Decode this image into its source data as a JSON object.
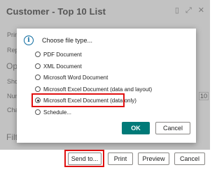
{
  "window": {
    "title": "Customer - Top 10 List"
  },
  "background": {
    "side_labels": [
      "Prin",
      "Rep",
      "Op",
      "Sho",
      "Nun",
      "Cha",
      "Filt"
    ],
    "number_value": "10"
  },
  "dialog": {
    "heading": "Choose file type...",
    "icon": "info-icon",
    "options": [
      {
        "label": "PDF Document",
        "selected": false
      },
      {
        "label": "XML Document",
        "selected": false
      },
      {
        "label": "Microsoft Word Document",
        "selected": false
      },
      {
        "label": "Microsoft Excel Document (data and layout)",
        "selected": false
      },
      {
        "label": "Microsoft Excel Document (data only)",
        "selected": true
      },
      {
        "label": "Schedule...",
        "selected": false
      }
    ],
    "ok_label": "OK",
    "cancel_label": "Cancel"
  },
  "footer": {
    "send_to_label": "Send to...",
    "print_label": "Print",
    "preview_label": "Preview",
    "cancel_label": "Cancel"
  },
  "colors": {
    "accent": "#007a78",
    "highlight": "#e01010",
    "info": "#0b6a9f"
  }
}
